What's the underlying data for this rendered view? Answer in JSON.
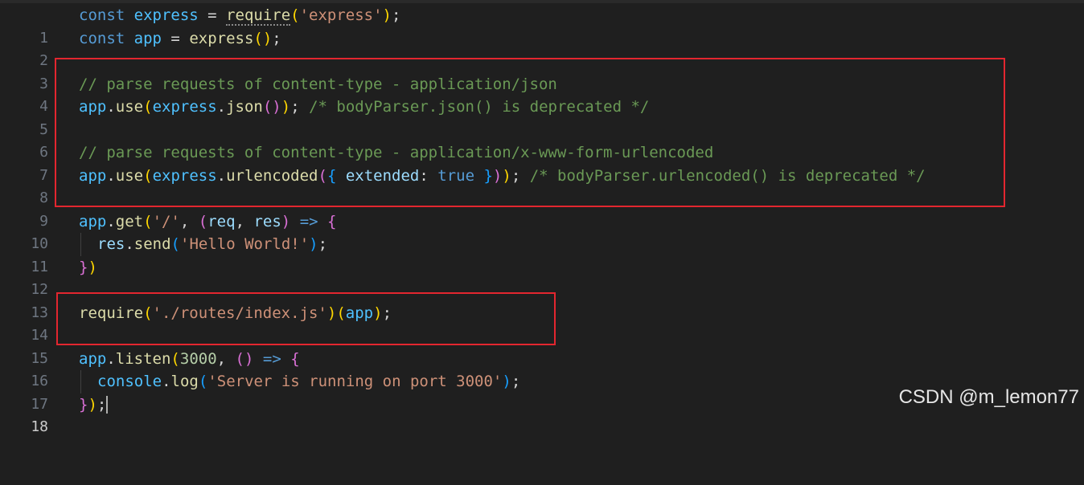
{
  "editor": {
    "line_numbers": [
      "1",
      "2",
      "3",
      "4",
      "5",
      "6",
      "7",
      "8",
      "9",
      "10",
      "11",
      "12",
      "13",
      "14",
      "15",
      "16",
      "17",
      "18"
    ],
    "active_line": "18",
    "tokens": {
      "const": "const",
      "express": "express",
      "app": "app",
      "eq": " = ",
      "require": "require",
      "str_express": "'express'",
      "paren_open": "(",
      "paren_close": ")",
      "semicolon": ";",
      "empty_parens": "()",
      "cmt_json": "// parse requests of content-type - application/json",
      "dot": ".",
      "use": "use",
      "json": "json",
      "cmt_json_dep": " /* bodyParser.json() is deprecated */",
      "cmt_urlenc": "// parse requests of content-type - application/x-www-form-urlencoded",
      "urlencoded": "urlencoded",
      "brace_open": "{",
      "brace_close": "}",
      "extended": "extended",
      "colon": ": ",
      "true": "true",
      "cmt_urlenc_dep": " /* bodyParser.urlencoded() is deprecated */",
      "get": "get",
      "str_root": "'/'",
      "comma": ", ",
      "req": "req",
      "res": "res",
      "arrow": "=>",
      "send": "send",
      "str_hello": "'Hello World!'",
      "str_routes": "'./routes/index.js'",
      "listen": "listen",
      "port": "3000",
      "console": "console",
      "log": "log",
      "str_server": "'Server is running on port 3000'",
      "space": " "
    }
  },
  "colors": {
    "background": "#1f1f1f",
    "highlight_box": "#e3262f",
    "keyword": "#569cd6",
    "variable": "#4fc1ff",
    "function": "#dcdcaa",
    "string": "#ce9178",
    "comment": "#6a9955"
  },
  "watermark": "CSDN @m_lemon77"
}
